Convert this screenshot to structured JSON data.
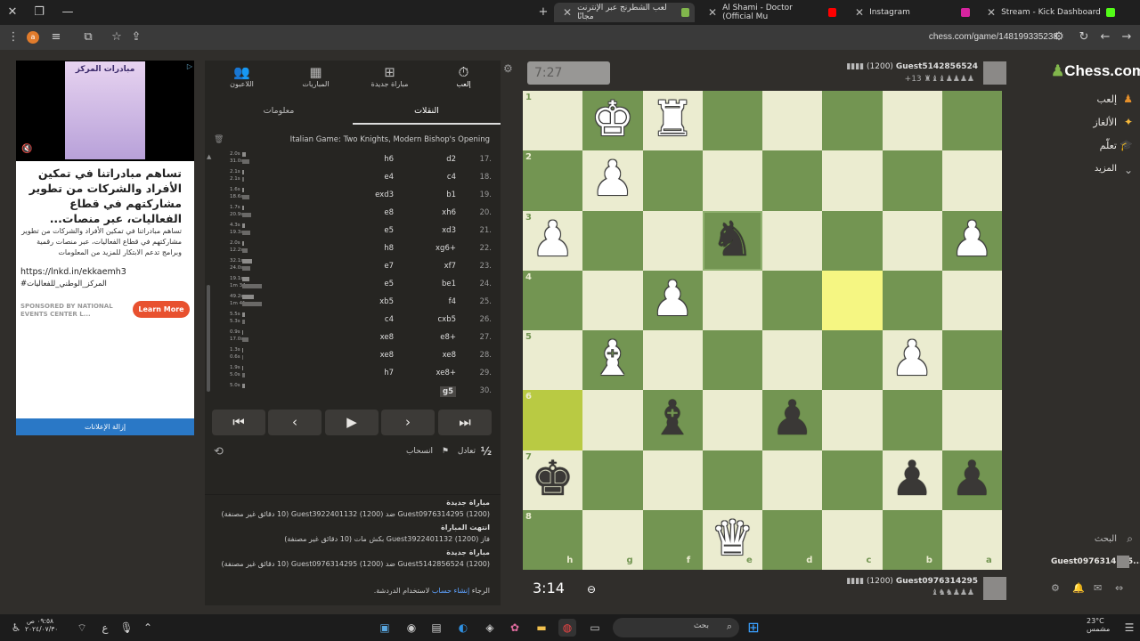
{
  "browser": {
    "tabs": [
      {
        "label": "Stream - Kick Dashboard",
        "color": "#53fc18"
      },
      {
        "label": "Instagram",
        "color": "#d6249f"
      },
      {
        "label": "Al Shami - Doctor (Official Mu",
        "color": "#ff0000"
      },
      {
        "label": "ﻟﻌﺐ ﺍﻟﺸﻄﺮﻧﺞ ﻋﺒﺮ ﺍﻹﻧﺘﺮﻧﺖ ﻣﺠﺎﻧًﺎ",
        "color": "#81b64c"
      }
    ],
    "url": "chess.com/game/148199335238"
  },
  "ad": {
    "card_title": "مبادرات المركز",
    "headline": "تساهم مبادراتنا في تمكين الأفراد والشركات من تطوير مشاركتهم في قطاع الفعاليات، عبر منصات...",
    "body": "تساهم مبادراتنا في تمكين الأفراد والشركات من تطوير مشاركتهم في قطاع الفعاليات، عبر منصات رقمية وبرامج تدعم الابتكار للمزيد من المعلومات",
    "link": "https://lnkd.in/ekkaemh3",
    "hashtag": "#المركز_الوطني_للفعاليات",
    "sponsor": "SPONSORED BY NATIONAL EVENTS CENTER L...",
    "cta": "Learn More",
    "remove": "إزالة الإعلانات"
  },
  "panel": {
    "nav": [
      "اللاعبون",
      "المباريات",
      "مباراة جديدة",
      "إلعب"
    ],
    "subtabs": [
      "معلومات",
      "النقلات"
    ],
    "opening": "Italian Game: Two Knights, Modern Bishop's Opening",
    "moves": [
      {
        "n": "17.",
        "w": "d2",
        "b": "h6",
        "t1": "2.0s",
        "t2": "31.0s"
      },
      {
        "n": "18.",
        "w": "c4",
        "b": "e4",
        "t1": "2.1s",
        "t2": "2.1s"
      },
      {
        "n": "19.",
        "w": "b1",
        "b": "exd3",
        "t1": "1.6s",
        "t2": "18.6s"
      },
      {
        "n": "20.",
        "w": "xh6",
        "b": "e8",
        "t1": "1.7s",
        "t2": "20.9s"
      },
      {
        "n": "21.",
        "w": "xd3",
        "b": "e5",
        "t1": "4.3s",
        "t2": "19.3s"
      },
      {
        "n": "22.",
        "w": "xg6+",
        "b": "h8",
        "t1": "2.0s",
        "t2": "12.2s"
      },
      {
        "n": "23.",
        "w": "xf7",
        "b": "e7",
        "t1": "32.1s",
        "t2": "24.0s"
      },
      {
        "n": "24.",
        "w": "be1",
        "b": "e5",
        "t1": "19.1s",
        "t2": "1m 34s"
      },
      {
        "n": "25.",
        "w": "f4",
        "b": "xb5",
        "t1": "49.2s",
        "t2": "1m 41s"
      },
      {
        "n": "26.",
        "w": "cxb5",
        "b": "c4",
        "t1": "5.5s",
        "t2": "5.3s"
      },
      {
        "n": "27.",
        "w": "e8+",
        "b": "xe8",
        "t1": "0.9s",
        "t2": "17.0s"
      },
      {
        "n": "28.",
        "w": "xe8",
        "b": "xe8",
        "t1": "1.3s",
        "t2": "0.6s"
      },
      {
        "n": "29.",
        "w": "xe8+",
        "b": "h7",
        "t1": "1.9s",
        "t2": "5.0s"
      },
      {
        "n": "30.",
        "w": "g5",
        "b": "",
        "t1": "5.0s",
        "t2": ""
      }
    ],
    "draw": "تعادل",
    "resign": "انسحاب",
    "half": "½",
    "log": [
      {
        "title": "مباراة جديدة",
        "text": "Guest0976314295 (1200) ضد Guest3922401132 (1200) (10 دقائق غير مصنفة)"
      },
      {
        "title": "انتهت المباراة",
        "text": "فاز Guest3922401132 (1200) بكش مات (10 دقائق غير مصنفة)"
      },
      {
        "title": "مباراة جديدة",
        "text": "Guest5142856524 (1200) ضد Guest0976314295 (1200) (10 دقائق غير مصنفة)"
      }
    ],
    "chat_prompt": "الرجاء",
    "chat_link": "إنشاء حساب",
    "chat_rest": "لاستخدام الدردشة."
  },
  "game": {
    "top_clock": "7:27",
    "bottom_clock": "3:14",
    "top_player": "Guest5142856524",
    "top_rating": "(1200)",
    "top_material": "+13",
    "bottom_player": "Guest0976314295",
    "bottom_rating": "(1200)",
    "ranks": [
      "1",
      "2",
      "3",
      "4",
      "5",
      "6",
      "7",
      "8"
    ],
    "files": [
      "h",
      "g",
      "f",
      "e",
      "d",
      "c",
      "b",
      "a"
    ]
  },
  "sidebar": {
    "logo": "Chess.com",
    "items": [
      "إلعب",
      "الألغاز",
      "تعلّم",
      "المزيد"
    ],
    "search": "البحث",
    "user": "Guest0976314295..."
  },
  "taskbar": {
    "search": "بحث",
    "time": "٠٩:٥٨ ص",
    "date": "٢٠٢٤/٠٧/٣٠",
    "weather": "23°C",
    "weather_desc": "مشمس"
  }
}
